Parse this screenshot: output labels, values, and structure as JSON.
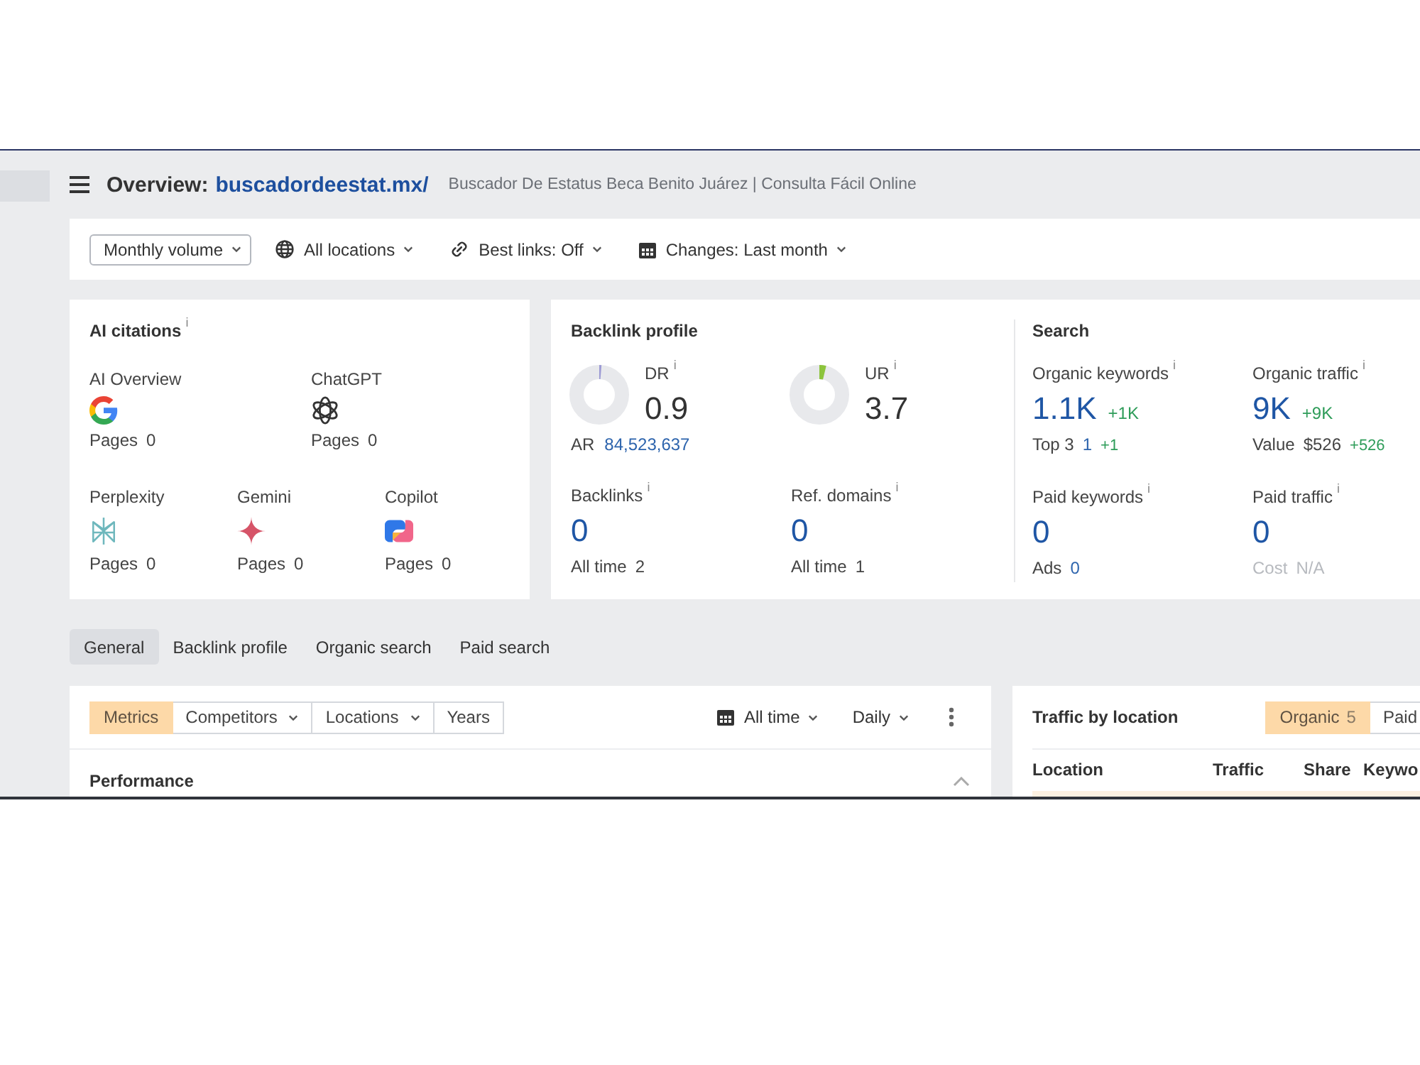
{
  "header": {
    "title": "Overview:",
    "domain": "buscadordeestat.mx/",
    "subtitle": "Buscador De Estatus Beca Benito Juárez | Consulta Fácil Online"
  },
  "toolbar": [
    {
      "kind": "select",
      "label": "Monthly volume"
    },
    {
      "kind": "globe",
      "label": "All locations"
    },
    {
      "kind": "link",
      "label": "Best links: Off"
    },
    {
      "kind": "calendar",
      "label": "Changes: Last month"
    }
  ],
  "ai_citations": {
    "title": "AI citations",
    "info": "i",
    "rows": [
      [
        {
          "name": "AI Overview",
          "kind": "google",
          "pages_label": "Pages",
          "pages": "0"
        },
        {
          "name": "ChatGPT",
          "kind": "chatgpt",
          "pages_label": "Pages",
          "pages": "0"
        }
      ],
      [
        {
          "name": "Perplexity",
          "kind": "perplexity",
          "pages_label": "Pages",
          "pages": "0"
        },
        {
          "name": "Gemini",
          "kind": "gemini",
          "pages_label": "Pages",
          "pages": "0"
        },
        {
          "name": "Copilot",
          "kind": "copilot",
          "pages_label": "Pages",
          "pages": "0"
        }
      ]
    ]
  },
  "backlink_profile": {
    "title": "Backlink profile",
    "ratings": [
      {
        "label": "DR",
        "info": "i",
        "value": "0.9",
        "color": "#9c9ad4"
      },
      {
        "label": "UR",
        "info": "i",
        "value": "3.7",
        "color": "#8cc43c"
      }
    ],
    "ar": {
      "label": "AR",
      "value": "84,523,637"
    },
    "metrics": [
      {
        "label": "Backlinks",
        "info": "i",
        "value": "0",
        "sub": {
          "label": "All time",
          "value": "2",
          "link": false,
          "disabled": false
        }
      },
      {
        "label": "Ref. domains",
        "info": "i",
        "value": "0",
        "sub": {
          "label": "All time",
          "value": "1",
          "link": false,
          "disabled": false
        }
      }
    ]
  },
  "search": {
    "title": "Search",
    "metrics": [
      {
        "label": "Organic keywords",
        "info": "i",
        "value": "1.1K",
        "change": "+1K",
        "sub": {
          "label": "Top 3",
          "value": "1",
          "change": "+1",
          "link": true,
          "disabled": false
        }
      },
      {
        "label": "Organic traffic",
        "info": "i",
        "value": "9K",
        "change": "+9K",
        "sub": {
          "label": "Value",
          "value": "$526",
          "change": "+526",
          "link": false,
          "disabled": false
        }
      },
      {
        "label": "Paid keywords",
        "info": "i",
        "value": "0",
        "sub": {
          "label": "Ads",
          "value": "0",
          "link": true,
          "disabled": false
        }
      },
      {
        "label": "Paid traffic",
        "info": "i",
        "value": "0",
        "sub": {
          "label": "Cost",
          "value": "N/A",
          "link": false,
          "disabled": true
        }
      }
    ]
  },
  "tabs": [
    {
      "label": "General",
      "selected": true
    },
    {
      "label": "Backlink profile",
      "selected": false
    },
    {
      "label": "Organic search",
      "selected": false
    },
    {
      "label": "Paid search",
      "selected": false
    }
  ],
  "performance": {
    "segments": [
      {
        "label": "Metrics",
        "selected": true,
        "dropdown": false
      },
      {
        "label": "Competitors",
        "selected": false,
        "dropdown": true
      },
      {
        "label": "Locations",
        "selected": false,
        "dropdown": true
      },
      {
        "label": "Years",
        "selected": false,
        "dropdown": false
      }
    ],
    "controls": [
      {
        "kind": "calendar",
        "label": "All time"
      },
      {
        "kind": "plain",
        "label": "Daily"
      }
    ],
    "title": "Performance",
    "expanded": true
  },
  "traffic_by_location": {
    "title": "Traffic by location",
    "segments": [
      {
        "label": "Organic",
        "count": "5",
        "selected": true
      },
      {
        "label": "Paid",
        "selected": false
      }
    ],
    "columns": [
      "Location",
      "Traffic",
      "Share",
      "Keywo"
    ]
  }
}
